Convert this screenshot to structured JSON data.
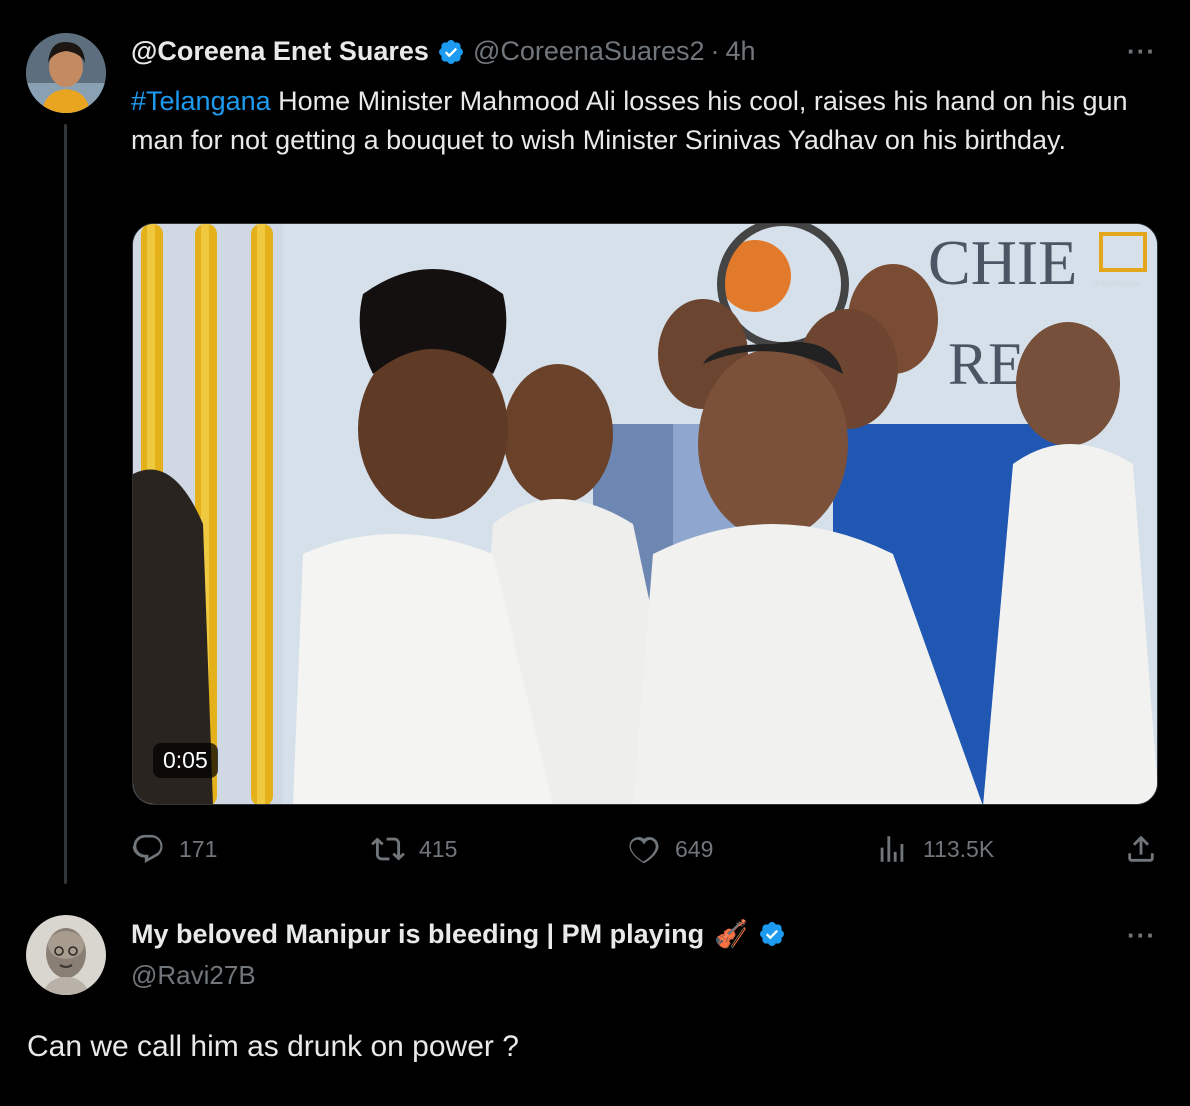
{
  "tweet": {
    "display_name": "@Coreena Enet Suares",
    "handle": "@CoreenaSuares2",
    "separator": "·",
    "time": "4h",
    "more_label": "···",
    "hashtag": "#Telangana",
    "text": " Home Minister Mahmood Ali losses his cool, raises his hand on his gun man for not getting a bouquet to wish Minister Srinivas Yadhav on his birthday.",
    "video_time": "0:05",
    "banner_text": "CHIE",
    "banner_text2": "RE",
    "watermark": "thaymhours"
  },
  "actions": {
    "replies": "171",
    "retweets": "415",
    "likes": "649",
    "views": "113.5K",
    "icons": [
      "reply-icon",
      "retweet-icon",
      "like-icon",
      "views-icon",
      "share-icon"
    ]
  },
  "reply": {
    "display_name": "My beloved Manipur is bleeding | PM playing",
    "emoji": "🎻",
    "handle": "@Ravi27B",
    "more_label": "···",
    "text": "Can we call him as drunk on power ?"
  },
  "colors": {
    "background": "#000000",
    "text": "#e7e9ea",
    "muted": "#71767b",
    "accent": "#1d9bf0",
    "verified": "#1d9bf0"
  }
}
